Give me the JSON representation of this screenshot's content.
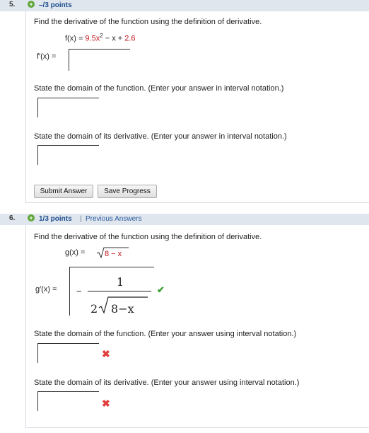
{
  "q5": {
    "number": "5.",
    "points": "–/3 points",
    "prompt": "Find the derivative of the function using the definition of derivative.",
    "func_lhs": "f(x) = ",
    "func_rhs_a": "9.5x",
    "func_exp": "2",
    "func_rhs_b": " − x + ",
    "func_rhs_c": "2.6",
    "deriv_label": "f′(x) =",
    "domain_prompt": "State the domain of the function. (Enter your answer in interval notation.)",
    "deriv_domain_prompt": "State the domain of its derivative. (Enter your answer in interval notation.)",
    "submit_label": "Submit Answer",
    "save_label": "Save Progress"
  },
  "q6": {
    "number": "6.",
    "points": "1/3 points",
    "separator": "|",
    "previous_answers": "Previous Answers",
    "prompt": "Find the derivative of the function using the definition of derivative.",
    "func_lhs": "g(x) = ",
    "func_radicand": "8 − x",
    "deriv_label": "g′(x) =",
    "answer_minus": "−",
    "answer_numerator": "1",
    "answer_coefficient": "2",
    "answer_radicand": "8−x",
    "domain_prompt": "State the domain of the function. (Enter your answer using interval notation.)",
    "deriv_domain_prompt": "State the domain of its derivative. (Enter your answer using interval notation.)"
  },
  "colors": {
    "header_bg": "#dfe6ee",
    "correct": "#3aa030",
    "incorrect": "#e0403e",
    "highlight": "#c0161c"
  },
  "icons": [
    "plus-icon",
    "check-icon",
    "x-icon"
  ]
}
